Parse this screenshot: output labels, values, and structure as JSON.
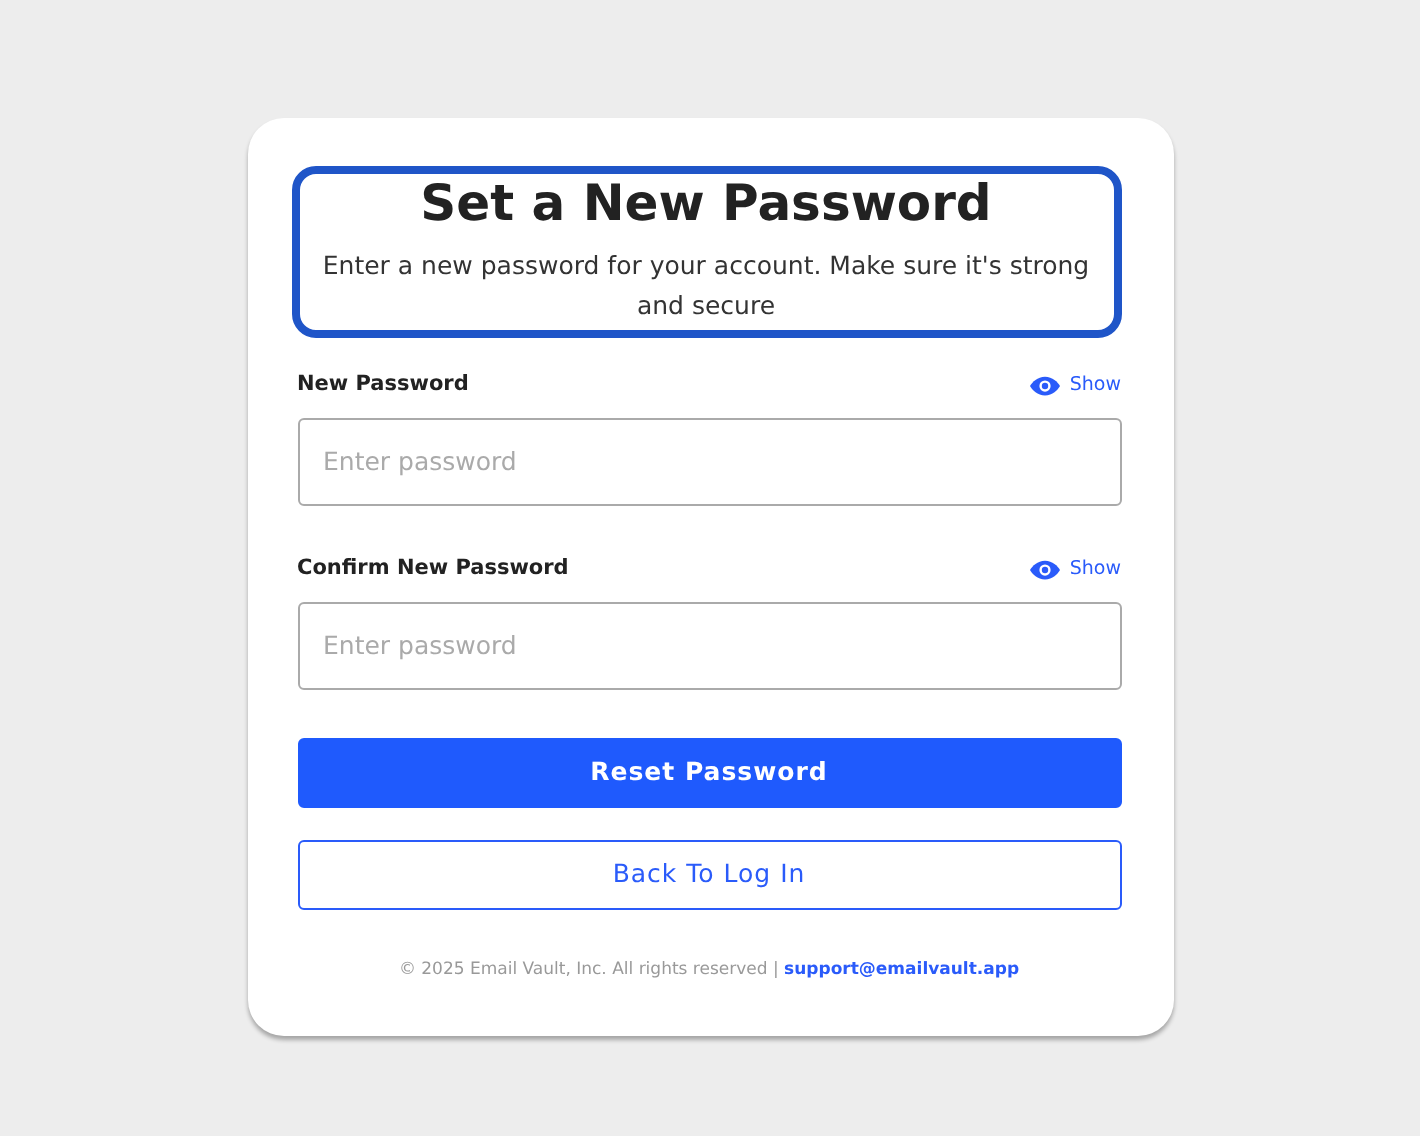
{
  "title": "Set a New Password",
  "subtitle": "Enter a new password for your account. Make sure it's strong and secure",
  "fields": [
    {
      "label": "New Password",
      "toggle": "Show",
      "placeholder": "Enter password"
    },
    {
      "label": "Confirm New Password",
      "toggle": "Show",
      "placeholder": "Enter password"
    }
  ],
  "buttons": [
    {
      "label": "Reset Password",
      "kind": "primary"
    },
    {
      "label": "Back To Log In",
      "kind": "outline"
    }
  ],
  "footer": {
    "text": "© 2025 Email Vault, Inc. All rights reserved |",
    "link": "support@emailvault.app"
  }
}
